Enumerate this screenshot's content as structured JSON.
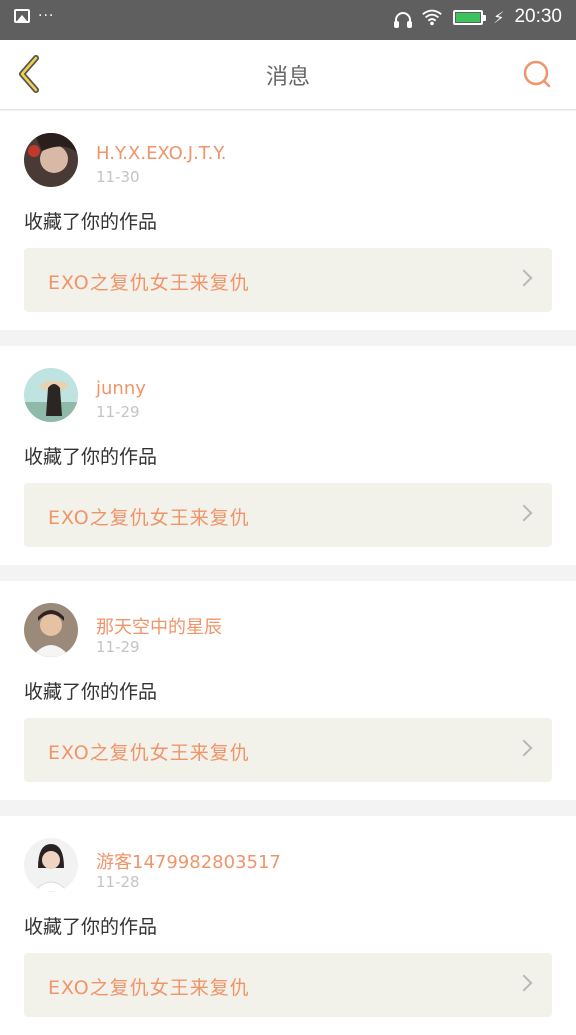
{
  "status_bar": {
    "left_icons": [
      "image-icon",
      "more-dots-icon"
    ],
    "more_text": "···",
    "time": "20:30",
    "battery_color": "#3cc35b"
  },
  "header": {
    "title": "消息",
    "back_icon": "back-chevron-icon",
    "search_icon": "search-icon",
    "accent_color": "#f0956a"
  },
  "messages": [
    {
      "username": "H.Y.X.EXO.J.T.Y.",
      "date": "11-30",
      "action": "收藏了你的作品",
      "work_title": "EXO之复仇女王来复仇"
    },
    {
      "username": "junny",
      "date": "11-29",
      "action": "收藏了你的作品",
      "work_title": "EXO之复仇女王来复仇"
    },
    {
      "username": "那天空中的星辰",
      "date": "11-29",
      "action": "收藏了你的作品",
      "work_title": "EXO之复仇女王来复仇"
    },
    {
      "username": "游客1479982803517",
      "date": "11-28",
      "action": "收藏了你的作品",
      "work_title": "EXO之复仇女王来复仇"
    }
  ]
}
